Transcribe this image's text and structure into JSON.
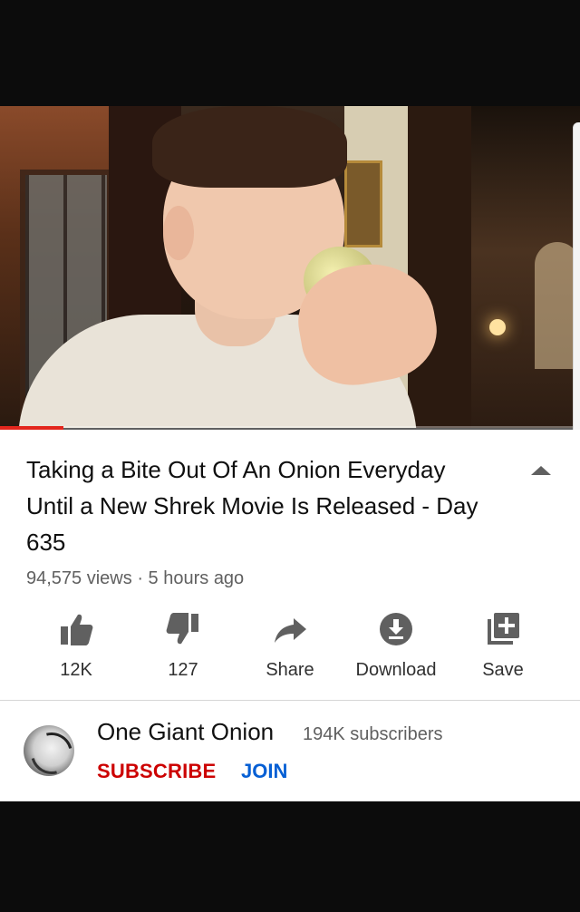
{
  "video": {
    "title": "Taking a Bite Out Of An Onion Everyday Until a New Shrek Movie Is Released - Day 635",
    "views": "94,575 views",
    "separator": "·",
    "posted": "5 hours ago",
    "progress_fraction": 0.11,
    "progress_color": "#e3261d"
  },
  "actions": [
    {
      "id": "like",
      "icon": "thumbs-up-icon",
      "label": "12K"
    },
    {
      "id": "dislike",
      "icon": "thumbs-down-icon",
      "label": "127"
    },
    {
      "id": "share",
      "icon": "share-arrow-icon",
      "label": "Share"
    },
    {
      "id": "download",
      "icon": "download-icon",
      "label": "Download"
    },
    {
      "id": "save",
      "icon": "playlist-add-icon",
      "label": "Save"
    }
  ],
  "channel": {
    "name": "One Giant Onion",
    "subscribers": "194K subscribers",
    "subscribe_label": "SUBSCRIBE",
    "join_label": "JOIN",
    "subscribe_color": "#cc0000",
    "join_color": "#065fd4"
  }
}
